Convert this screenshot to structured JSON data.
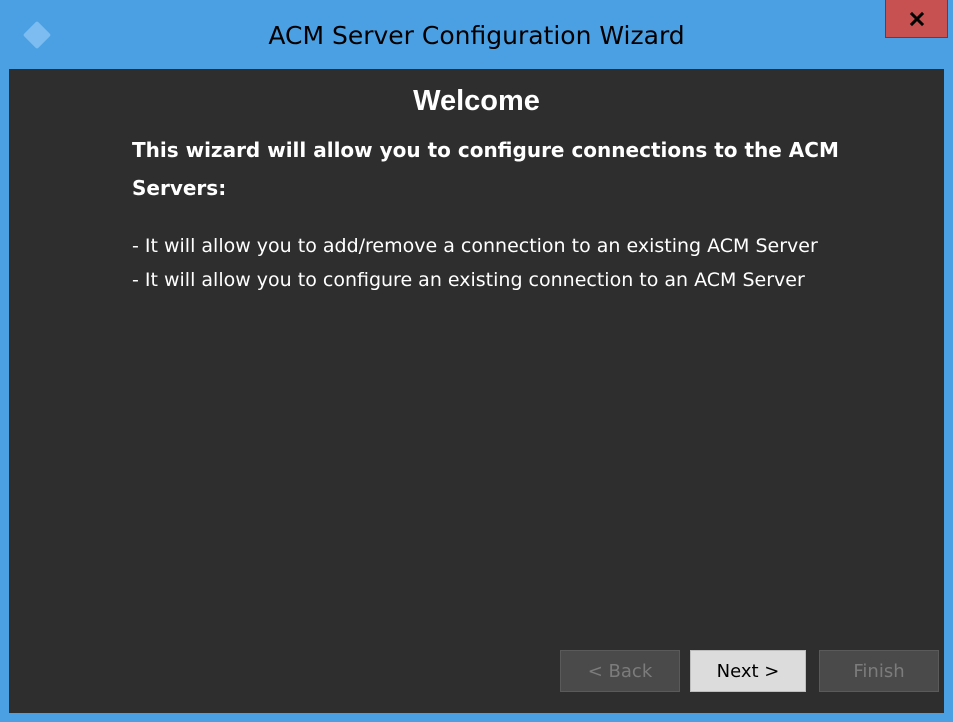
{
  "window": {
    "title": "ACM Server Configuration Wizard",
    "close_icon": "close-x-icon",
    "app_icon": "diamond-icon"
  },
  "content": {
    "heading": "Welcome",
    "intro": "This wizard will allow you to configure connections to the ACM Servers:",
    "bullets": [
      "- It will allow you to add/remove a connection to an existing ACM Server",
      "- It will allow you to configure an existing connection to an ACM Server"
    ]
  },
  "buttons": {
    "back_label": "< Back",
    "next_label": "Next >",
    "finish_label": "Finish"
  },
  "colors": {
    "titlebar": "#4aa0e3",
    "close_button": "#c75050",
    "client_background": "#2e2e2e",
    "text": "#ffffff"
  }
}
